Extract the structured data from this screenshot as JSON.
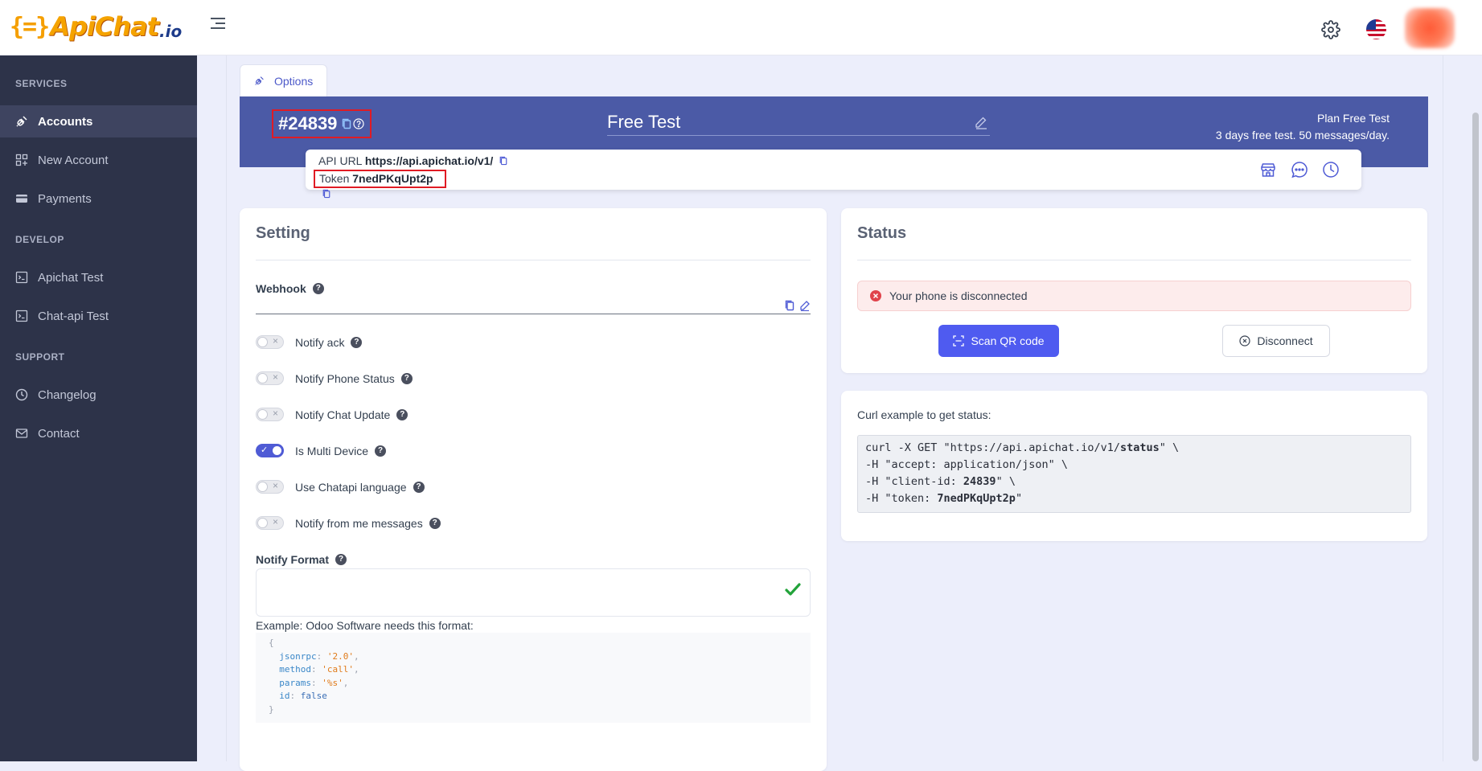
{
  "brand": {
    "braces": "{=}",
    "name": "ApiChat",
    "tld": ".io"
  },
  "header": {
    "settings_icon": "gear-icon",
    "language_icon": "us-flag-icon",
    "avatar_icon": "user-avatar"
  },
  "sidebar": {
    "sections": [
      {
        "title": "SERVICES",
        "items": [
          {
            "label": "Accounts",
            "icon": "plug-icon",
            "active": true
          },
          {
            "label": "New Account",
            "icon": "grid-plus-icon"
          },
          {
            "label": "Payments",
            "icon": "card-icon"
          }
        ]
      },
      {
        "title": "DEVELOP",
        "items": [
          {
            "label": "Apichat Test",
            "icon": "terminal-icon"
          },
          {
            "label": "Chat-api Test",
            "icon": "terminal-icon"
          }
        ]
      },
      {
        "title": "SUPPORT",
        "items": [
          {
            "label": "Changelog",
            "icon": "clock-icon"
          },
          {
            "label": "Contact",
            "icon": "mail-icon"
          }
        ]
      }
    ]
  },
  "tab": {
    "label": "Options"
  },
  "account": {
    "id": "#24839",
    "plan_name": "Free Test",
    "plan_title": "Plan Free Test",
    "plan_desc": "3 days free test. 50 messages/day.",
    "api_url_label": "API URL",
    "api_url": "https://api.apichat.io/v1/",
    "token_label": "Token",
    "token": "7nedPKqUpt2p"
  },
  "setting": {
    "title": "Setting",
    "webhook_label": "Webhook",
    "toggles": [
      {
        "label": "Notify ack",
        "on": false
      },
      {
        "label": "Notify Phone Status",
        "on": false
      },
      {
        "label": "Notify Chat Update",
        "on": false
      },
      {
        "label": "Is Multi Device",
        "on": true
      },
      {
        "label": "Use Chatapi language",
        "on": false
      },
      {
        "label": "Notify from me messages",
        "on": false
      }
    ],
    "format_label": "Notify Format",
    "example_label": "Example: Odoo Software needs this format:",
    "example_code": {
      "open": "{",
      "jsonrpc_key": "jsonrpc",
      "jsonrpc_val": "'2.0'",
      "method_key": "method",
      "method_val": "'call'",
      "params_key": "params",
      "params_val": "'%s'",
      "id_key": "id",
      "id_val": "false",
      "close": "}"
    }
  },
  "status": {
    "title": "Status",
    "alert": "Your phone is disconnected",
    "scan_button": "Scan QR code",
    "disconnect_button": "Disconnect"
  },
  "curl": {
    "label": "Curl example to get status:",
    "l1a": "curl -X GET \"https://api.apichat.io/v1/",
    "l1b": "status",
    "l1c": "\" \\",
    "l2": "-H \"accept: application/json\" \\",
    "l3a": "-H \"client-id: ",
    "l3b": "24839",
    "l3c": "\" \\",
    "l4a": "-H \"token: ",
    "l4b": "7nedPKqUpt2p",
    "l4c": "\""
  },
  "colors": {
    "sidebar": "#2d3349",
    "banner": "#4b5aa6",
    "primary": "#4f5bf0",
    "danger": "#e01b24"
  }
}
